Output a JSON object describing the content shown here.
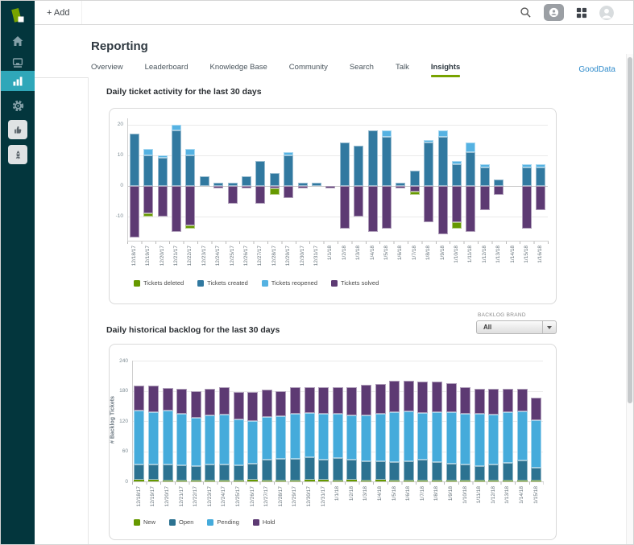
{
  "topbar": {
    "add_label": "+ Add"
  },
  "sidebar": {
    "icons": [
      "zendesk-logo",
      "home",
      "views-queue",
      "reporting",
      "admin-gear",
      "feedback",
      "onboarding"
    ],
    "active_item": "reporting"
  },
  "header": {
    "title": "Reporting",
    "tabs": [
      {
        "label": "Overview",
        "active": false
      },
      {
        "label": "Leaderboard",
        "active": false
      },
      {
        "label": "Knowledge Base",
        "active": false
      },
      {
        "label": "Community",
        "active": false
      },
      {
        "label": "Search",
        "active": false
      },
      {
        "label": "Talk",
        "active": false
      },
      {
        "label": "Insights",
        "active": true
      }
    ],
    "external_link_label": "GoodData"
  },
  "filters": {
    "backlog_brand": {
      "label": "BACKLOG BRAND",
      "value": "All"
    }
  },
  "colors": {
    "sidebar_bg": "#03363D",
    "sidebar_active_bg": "#2FA7B9",
    "tab_underline": "#78A300",
    "link_blue": "#2F8BCB",
    "green": "#669900",
    "created_blue": "#3179A0",
    "reopened_blue": "#55B2E2",
    "purple": "#5D3A73",
    "open_blue": "#2C7291",
    "pending_blue": "#45ABDB"
  },
  "chart_data": [
    {
      "type": "bar",
      "stacked": true,
      "diverging": true,
      "title": "Daily ticket activity for the last 30 days",
      "xlabel": "",
      "ylabel": "",
      "ylim": [
        -18,
        22
      ],
      "yticks": [
        20,
        10,
        0,
        -10
      ],
      "grid": true,
      "legend_position": "bottom",
      "categories": [
        "12/18/17",
        "12/19/17",
        "12/20/17",
        "12/21/17",
        "12/22/17",
        "12/23/17",
        "12/24/17",
        "12/25/17",
        "12/26/17",
        "12/27/17",
        "12/28/17",
        "12/29/17",
        "12/30/17",
        "12/31/17",
        "1/1/18",
        "1/2/18",
        "1/3/18",
        "1/4/18",
        "1/5/18",
        "1/6/18",
        "1/7/18",
        "1/8/18",
        "1/9/18",
        "1/10/18",
        "1/11/18",
        "1/12/18",
        "1/13/18",
        "1/14/18",
        "1/15/18",
        "1/16/18"
      ],
      "series": [
        {
          "name": "Tickets deleted",
          "color": "#669900",
          "values": [
            0,
            -1,
            0,
            0,
            -1,
            0,
            0,
            0,
            0,
            0,
            -2,
            0,
            0,
            0,
            0,
            0,
            0,
            0,
            0,
            0,
            -1,
            0,
            0,
            -2,
            0,
            0,
            0,
            0,
            0,
            0
          ]
        },
        {
          "name": "Tickets created",
          "color": "#3179A0",
          "values": [
            17,
            10,
            9,
            18,
            10,
            3,
            1,
            1,
            3,
            8,
            4,
            10,
            1,
            1,
            0,
            14,
            13,
            18,
            16,
            1,
            5,
            14,
            16,
            7,
            11,
            6,
            2,
            0,
            6,
            6
          ]
        },
        {
          "name": "Tickets reopened",
          "color": "#55B2E2",
          "values": [
            0,
            2,
            1,
            2,
            2,
            0,
            0,
            0,
            0,
            0,
            0,
            1,
            0,
            0,
            0,
            0,
            0,
            0,
            2,
            0,
            0,
            1,
            2,
            1,
            3,
            1,
            0,
            0,
            1,
            1
          ]
        },
        {
          "name": "Tickets solved",
          "color": "#5D3A73",
          "values": [
            -17,
            -9,
            -10,
            -15,
            -13,
            0,
            -1,
            -6,
            -1,
            -6,
            -1,
            -4,
            -1,
            0,
            -1,
            -14,
            -10,
            -15,
            -14,
            -1,
            -2,
            -12,
            -16,
            -12,
            -15,
            -8,
            -3,
            0,
            -14,
            -8
          ]
        }
      ],
      "stack_order": [
        1,
        2,
        3,
        0
      ]
    },
    {
      "type": "bar",
      "stacked": true,
      "diverging": false,
      "title": "Daily historical backlog for the last 30 days",
      "xlabel": "",
      "ylabel": "# Backlog Tickets",
      "ylim": [
        0,
        240
      ],
      "yticks": [
        0,
        60,
        120,
        180,
        240
      ],
      "grid": true,
      "legend_position": "bottom",
      "categories": [
        "12/18/17",
        "12/19/17",
        "12/20/17",
        "12/21/17",
        "12/22/17",
        "12/23/17",
        "12/24/17",
        "12/25/17",
        "12/26/17",
        "12/27/17",
        "12/28/17",
        "12/29/17",
        "12/30/17",
        "12/31/17",
        "1/1/18",
        "1/2/18",
        "1/3/18",
        "1/4/18",
        "1/5/18",
        "1/6/18",
        "1/7/18",
        "1/8/18",
        "1/9/18",
        "1/10/18",
        "1/11/18",
        "1/12/18",
        "1/13/18",
        "1/14/18",
        "1/15/18"
      ],
      "series": [
        {
          "name": "New",
          "color": "#669900",
          "values": [
            3,
            3,
            2,
            2,
            2,
            2,
            2,
            2,
            4,
            2,
            2,
            2,
            3,
            3,
            2,
            3,
            2,
            3,
            1,
            1,
            1,
            1,
            1,
            1,
            2,
            1,
            1,
            1,
            1
          ]
        },
        {
          "name": "Open",
          "color": "#2C7291",
          "values": [
            31,
            31,
            32,
            30,
            28,
            32,
            32,
            30,
            31,
            41,
            43,
            43,
            45,
            41,
            45,
            41,
            38,
            37,
            38,
            39,
            42,
            38,
            35,
            33,
            29,
            33,
            36,
            41,
            27
          ]
        },
        {
          "name": "Pending",
          "color": "#45ABDB",
          "values": [
            107,
            104,
            107,
            103,
            97,
            98,
            99,
            91,
            85,
            85,
            85,
            90,
            88,
            90,
            87,
            88,
            91,
            94,
            99,
            99,
            93,
            98,
            101,
            101,
            103,
            99,
            101,
            97,
            93
          ]
        },
        {
          "name": "Hold",
          "color": "#5D3A73",
          "values": [
            50,
            53,
            44,
            49,
            52,
            52,
            54,
            55,
            57,
            55,
            50,
            52,
            52,
            54,
            54,
            56,
            61,
            60,
            62,
            61,
            62,
            62,
            58,
            52,
            50,
            51,
            46,
            45,
            45
          ]
        }
      ],
      "stack_order": [
        0,
        1,
        2,
        3
      ]
    }
  ]
}
